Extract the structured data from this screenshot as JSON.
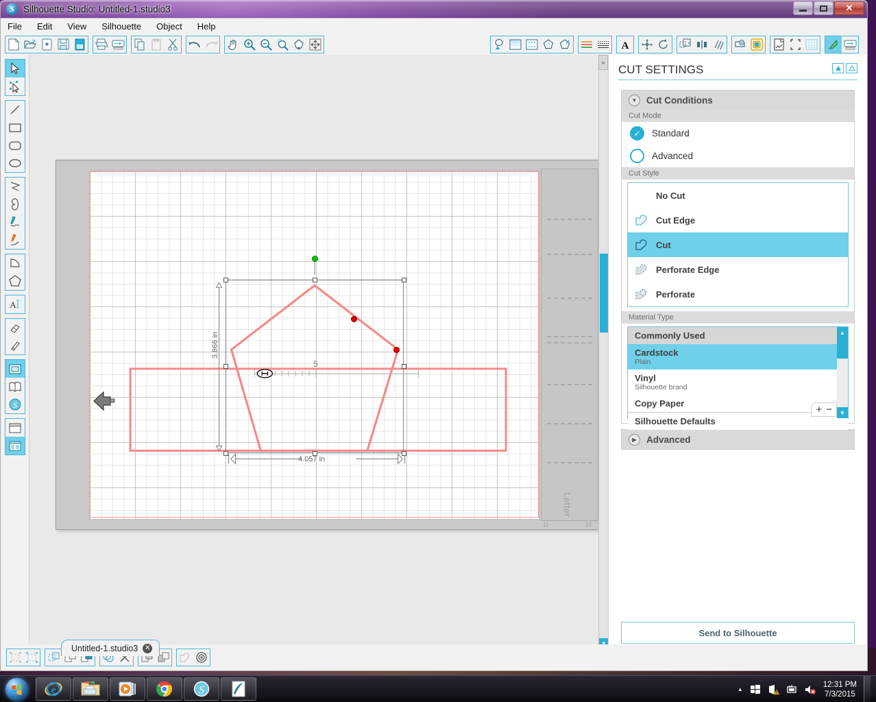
{
  "window": {
    "title": "Silhouette Studio: Untitled-1.studio3",
    "app_icon": "silhouette-logo-icon",
    "minimize_label": "–",
    "maximize_label": "□",
    "close_label": "✕"
  },
  "menubar": {
    "items": [
      {
        "label": "File"
      },
      {
        "label": "Edit"
      },
      {
        "label": "View"
      },
      {
        "label": "Silhouette"
      },
      {
        "label": "Object"
      },
      {
        "label": "Help"
      }
    ]
  },
  "toolbar": {
    "groups": [
      {
        "name": "file",
        "buttons": [
          {
            "name": "new-document-button",
            "icon": "page-icon"
          },
          {
            "name": "open-button",
            "icon": "folder-open-icon"
          },
          {
            "name": "new-from-library-button",
            "icon": "page-star-icon"
          },
          {
            "name": "save-button",
            "icon": "floppy-disk-icon"
          },
          {
            "name": "save-as-id-button",
            "icon": "save-id-icon"
          }
        ]
      },
      {
        "name": "print",
        "buttons": [
          {
            "name": "print-button",
            "icon": "printer-icon"
          },
          {
            "name": "print-preview-button",
            "icon": "print-preview-icon"
          }
        ]
      },
      {
        "name": "clipboard",
        "buttons": [
          {
            "name": "copy-button",
            "icon": "copy-icon"
          },
          {
            "name": "paste-button",
            "icon": "paste-icon"
          },
          {
            "name": "cut-button",
            "icon": "scissors-icon"
          }
        ]
      },
      {
        "name": "history",
        "buttons": [
          {
            "name": "undo-button",
            "icon": "undo-arrow-icon"
          },
          {
            "name": "redo-button",
            "icon": "redo-arrow-icon"
          }
        ]
      },
      {
        "name": "view",
        "buttons": [
          {
            "name": "pan-button",
            "icon": "hand-icon"
          },
          {
            "name": "zoom-in-button",
            "icon": "magnifier-plus-icon"
          },
          {
            "name": "zoom-out-button",
            "icon": "magnifier-minus-icon"
          },
          {
            "name": "zoom-selection-button",
            "icon": "magnifier-selection-icon"
          },
          {
            "name": "zoom-region-button",
            "icon": "zoom-region-icon"
          },
          {
            "name": "fit-to-window-button",
            "icon": "fit-window-icon"
          }
        ]
      }
    ],
    "right_groups": [
      {
        "name": "styling",
        "buttons": [
          {
            "name": "fill-color-button",
            "icon": "paint-bucket-icon"
          },
          {
            "name": "gradient-fill-button",
            "icon": "gradient-square-icon"
          },
          {
            "name": "pattern-fill-button",
            "icon": "pattern-square-icon"
          },
          {
            "name": "line-color-button",
            "icon": "outline-shape-icon"
          },
          {
            "name": "line-style-button",
            "icon": "line-style-shape-icon"
          }
        ]
      },
      {
        "name": "text-lines",
        "buttons": [
          {
            "name": "line-thickness-button",
            "icon": "color-lines-icon"
          },
          {
            "name": "sketch-lines-button",
            "icon": "dashed-lines-icon"
          }
        ]
      },
      {
        "name": "text",
        "buttons": [
          {
            "name": "text-style-button",
            "icon": "letter-a-icon"
          }
        ]
      },
      {
        "name": "transform",
        "buttons": [
          {
            "name": "move-object-button",
            "icon": "four-arrow-move-icon"
          },
          {
            "name": "rotate-object-button",
            "icon": "rotate-arrow-icon"
          }
        ]
      },
      {
        "name": "arrange",
        "buttons": [
          {
            "name": "scale-button",
            "icon": "scale-icon"
          },
          {
            "name": "align-button",
            "icon": "align-icon"
          },
          {
            "name": "replicate-button",
            "icon": "replicate-icon"
          }
        ]
      },
      {
        "name": "mods",
        "buttons": [
          {
            "name": "modify-button",
            "icon": "modify-shape-icon"
          },
          {
            "name": "offset-button",
            "icon": "offset-square-icon"
          }
        ]
      },
      {
        "name": "page",
        "buttons": [
          {
            "name": "page-setup-button",
            "icon": "page-setup-icon"
          },
          {
            "name": "registration-marks-button",
            "icon": "registration-mark-icon"
          },
          {
            "name": "grid-button",
            "icon": "grid-icon"
          }
        ]
      },
      {
        "name": "cut",
        "buttons": [
          {
            "name": "cut-settings-button",
            "icon": "blade-icon",
            "selected": true
          },
          {
            "name": "send-to-silhouette-button",
            "icon": "cutting-machine-icon"
          }
        ]
      }
    ]
  },
  "left_rail": {
    "groups": [
      {
        "buttons": [
          {
            "name": "select-tool",
            "icon": "arrow-cursor-icon",
            "selected": true
          },
          {
            "name": "edit-points-tool",
            "icon": "edit-points-icon"
          }
        ]
      },
      {
        "buttons": [
          {
            "name": "line-tool",
            "icon": "line-icon"
          },
          {
            "name": "rectangle-tool",
            "icon": "rectangle-icon"
          },
          {
            "name": "rounded-rectangle-tool",
            "icon": "rounded-rectangle-icon"
          },
          {
            "name": "ellipse-tool",
            "icon": "ellipse-icon"
          }
        ]
      },
      {
        "buttons": [
          {
            "name": "polygon-tool",
            "icon": "polyline-icon"
          },
          {
            "name": "curve-tool",
            "icon": "curve-icon"
          },
          {
            "name": "freehand-tool",
            "icon": "freehand-pen-icon"
          },
          {
            "name": "smooth-freehand-tool",
            "icon": "smooth-freehand-icon"
          }
        ]
      },
      {
        "buttons": [
          {
            "name": "arc-tool",
            "icon": "arc-icon"
          },
          {
            "name": "regular-polygon-tool",
            "icon": "pentagon-icon"
          }
        ]
      },
      {
        "buttons": [
          {
            "name": "text-tool",
            "icon": "text-a-icon"
          }
        ]
      },
      {
        "buttons": [
          {
            "name": "eraser-tool",
            "icon": "eraser-icon"
          },
          {
            "name": "knife-tool",
            "icon": "knife-icon"
          }
        ]
      },
      {
        "buttons": [
          {
            "name": "design-page-tab",
            "icon": "design-page-icon",
            "selected": true
          },
          {
            "name": "library-tab",
            "icon": "open-book-icon"
          },
          {
            "name": "silhouette-store-tab",
            "icon": "silhouette-store-icon"
          }
        ]
      },
      {
        "buttons": [
          {
            "name": "single-panel-view",
            "icon": "single-panel-icon"
          },
          {
            "name": "split-panel-view",
            "icon": "split-panel-icon",
            "selected": true
          }
        ]
      }
    ]
  },
  "canvas": {
    "mat_label": "Letter",
    "ruler_ticks_right": [
      "11",
      "12"
    ],
    "selection": {
      "width_label": "4.057 in",
      "height_label": "3.866 in",
      "slider_value": "5",
      "rotate_handle": "rotation-handle-green",
      "node_points": 2
    },
    "cursor": "left-arrow-cursor"
  },
  "document_tab": {
    "label": "Untitled-1.studio3",
    "close_label": "✕"
  },
  "cut_settings": {
    "title": "CUT SETTINGS",
    "header_buttons": [
      {
        "name": "panel-expand-button",
        "glyph": "▲"
      },
      {
        "name": "panel-collapse-button",
        "glyph": "△"
      }
    ],
    "cut_conditions": {
      "header": "Cut Conditions",
      "expanded": true,
      "cut_mode": {
        "label": "Cut Mode",
        "options": [
          {
            "label": "Standard",
            "selected": true
          },
          {
            "label": "Advanced",
            "selected": false
          }
        ]
      },
      "cut_style": {
        "label": "Cut Style",
        "options": [
          {
            "label": "No Cut",
            "icon": "none",
            "selected": false
          },
          {
            "label": "Cut Edge",
            "icon": "cut-edge-icon",
            "selected": false
          },
          {
            "label": "Cut",
            "icon": "cut-icon",
            "selected": true
          },
          {
            "label": "Perforate Edge",
            "icon": "perforate-edge-icon",
            "selected": false
          },
          {
            "label": "Perforate",
            "icon": "perforate-icon",
            "selected": false
          }
        ]
      },
      "material_type": {
        "label": "Material Type",
        "items": [
          {
            "label": "Commonly Used",
            "sub": "",
            "group": true,
            "selected": false
          },
          {
            "label": "Cardstock",
            "sub": "Plain",
            "group": false,
            "selected": true
          },
          {
            "label": "Vinyl",
            "sub": "Silhouette brand",
            "group": false,
            "selected": false
          },
          {
            "label": "Copy Paper",
            "sub": "",
            "group": false,
            "selected": false
          },
          {
            "label": "Silhouette Defaults",
            "sub": "",
            "group": true,
            "selected": false
          }
        ],
        "add_label": "+",
        "remove_label": "−"
      }
    },
    "advanced": {
      "header": "Advanced",
      "expanded": false
    },
    "send_button": "Send to Silhouette",
    "footer_icons": [
      {
        "name": "settings-gear-icon"
      },
      {
        "name": "refresh-sync-icon"
      }
    ]
  },
  "bottom_bar": {
    "groups": [
      {
        "buttons": [
          {
            "name": "group-button",
            "icon": "group-icon"
          },
          {
            "name": "ungroup-button",
            "icon": "ungroup-icon"
          }
        ]
      },
      {
        "buttons": [
          {
            "name": "make-compound-path-button",
            "icon": "compound-path-icon"
          },
          {
            "name": "bring-forward-button",
            "icon": "bring-forward-icon"
          },
          {
            "name": "send-backward-button",
            "icon": "send-backward-icon"
          }
        ]
      },
      {
        "buttons": [
          {
            "name": "weld-button",
            "icon": "weld-icon"
          },
          {
            "name": "detach-lines-button",
            "icon": "detach-x-icon"
          }
        ]
      },
      {
        "buttons": [
          {
            "name": "bring-to-front-button",
            "icon": "bring-front-icon"
          },
          {
            "name": "send-to-back-button",
            "icon": "send-back-icon"
          }
        ]
      },
      {
        "buttons": [
          {
            "name": "release-compound-button",
            "icon": "release-shape-icon"
          },
          {
            "name": "offset-shape-button",
            "icon": "concentric-circles-icon"
          }
        ]
      }
    ]
  },
  "taskbar": {
    "start_label": "start-orb-icon",
    "apps": [
      {
        "name": "internet-explorer-taskbar-icon"
      },
      {
        "name": "file-explorer-taskbar-icon"
      },
      {
        "name": "media-player-taskbar-icon"
      },
      {
        "name": "google-chrome-taskbar-icon"
      },
      {
        "name": "silhouette-studio-taskbar-icon"
      },
      {
        "name": "writer-feather-taskbar-icon"
      }
    ],
    "tray": {
      "show_hidden_label": "▲",
      "icons": [
        {
          "name": "windows-flag-tray-icon"
        },
        {
          "name": "network-warning-tray-icon"
        },
        {
          "name": "action-center-tray-icon"
        },
        {
          "name": "volume-muted-tray-icon"
        }
      ],
      "time": "12:31 PM",
      "date": "7/3/2015"
    }
  },
  "colors": {
    "accent": "#29b0d6",
    "accent_light": "#6fd0ea",
    "shape_stroke": "#f58a8a",
    "node_red": "#e60000",
    "node_green": "#00cc00"
  }
}
